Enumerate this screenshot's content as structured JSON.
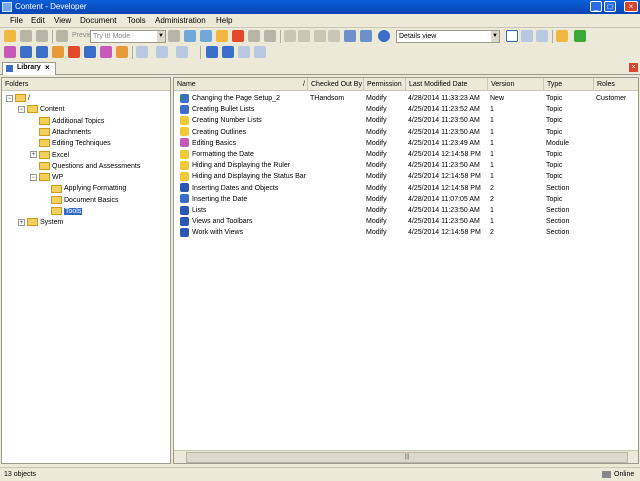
{
  "window": {
    "title": "Content - Developer"
  },
  "menu": [
    "File",
    "Edit",
    "View",
    "Document",
    "Tools",
    "Administration",
    "Help"
  ],
  "toolbar": {
    "preview_label": "Preview",
    "mode_select": "Try It! Mode",
    "view_select": "Details view"
  },
  "tab": {
    "label": "Library",
    "close": "×"
  },
  "folders_header": "Folders",
  "tree": [
    {
      "label": "/",
      "level": 0,
      "expander": "−"
    },
    {
      "label": "Content",
      "level": 1,
      "expander": "−"
    },
    {
      "label": "Additional Topics",
      "level": 2,
      "expander": ""
    },
    {
      "label": "Attachments",
      "level": 2,
      "expander": ""
    },
    {
      "label": "Editing Techniques",
      "level": 2,
      "expander": ""
    },
    {
      "label": "Excel",
      "level": 2,
      "expander": "+"
    },
    {
      "label": "Questions and Assessments",
      "level": 2,
      "expander": ""
    },
    {
      "label": "WP",
      "level": 2,
      "expander": "−"
    },
    {
      "label": "Applying Formatting",
      "level": 3,
      "expander": ""
    },
    {
      "label": "Document Basics",
      "level": 3,
      "expander": ""
    },
    {
      "label": "Tools",
      "level": 3,
      "expander": "",
      "selected": true
    },
    {
      "label": "System",
      "level": 1,
      "expander": "+"
    }
  ],
  "columns": [
    "Name",
    "/",
    "Checked Out By",
    "Permission",
    "Last Modified Date",
    "Version",
    "Type",
    "Roles"
  ],
  "rows": [
    {
      "name": "Changing the Page Setup_2",
      "checked": "THandsom",
      "perm": "Modify",
      "date": "4/28/2014 11:33:23 AM",
      "ver": "New",
      "type": "Topic",
      "roles": "Customer",
      "icon": "topic",
      "check": true
    },
    {
      "name": "Creating Bullet Lists",
      "checked": "",
      "perm": "Modify",
      "date": "4/25/2014 11:23:52 AM",
      "ver": "1",
      "type": "Topic",
      "roles": "",
      "icon": "topic"
    },
    {
      "name": "Creating Number Lists",
      "checked": "",
      "perm": "Modify",
      "date": "4/25/2014 11:23:50 AM",
      "ver": "1",
      "type": "Topic",
      "roles": "",
      "icon": "bulb"
    },
    {
      "name": "Creating Outlines",
      "checked": "",
      "perm": "Modify",
      "date": "4/25/2014 11:23:50 AM",
      "ver": "1",
      "type": "Topic",
      "roles": "",
      "icon": "bulb"
    },
    {
      "name": "Editing Basics",
      "checked": "",
      "perm": "Modify",
      "date": "4/25/2014 11:23:49 AM",
      "ver": "1",
      "type": "Module",
      "roles": "",
      "icon": "module"
    },
    {
      "name": "Formatting the Date",
      "checked": "",
      "perm": "Modify",
      "date": "4/25/2014 12:14:58 PM",
      "ver": "1",
      "type": "Topic",
      "roles": "",
      "icon": "bulb"
    },
    {
      "name": "Hiding and Displaying the Ruler",
      "checked": "",
      "perm": "Modify",
      "date": "4/25/2014 11:23:50 AM",
      "ver": "1",
      "type": "Topic",
      "roles": "",
      "icon": "bulb"
    },
    {
      "name": "Hiding and Displaying the Status Bar",
      "checked": "",
      "perm": "Modify",
      "date": "4/25/2014 12:14:58 PM",
      "ver": "1",
      "type": "Topic",
      "roles": "",
      "icon": "bulb"
    },
    {
      "name": "Inserting Dates and Objects",
      "checked": "",
      "perm": "Modify",
      "date": "4/25/2014 12:14:58 PM",
      "ver": "2",
      "type": "Section",
      "roles": "",
      "icon": "section"
    },
    {
      "name": "Inserting the Date",
      "checked": "",
      "perm": "Modify",
      "date": "4/28/2014 11:07:05 AM",
      "ver": "2",
      "type": "Topic",
      "roles": "",
      "icon": "topic"
    },
    {
      "name": "Lists",
      "checked": "",
      "perm": "Modify",
      "date": "4/25/2014 11:23:50 AM",
      "ver": "1",
      "type": "Section",
      "roles": "",
      "icon": "section"
    },
    {
      "name": "Views and Toolbars",
      "checked": "",
      "perm": "Modify",
      "date": "4/25/2014 11:23:50 AM",
      "ver": "1",
      "type": "Section",
      "roles": "",
      "icon": "section"
    },
    {
      "name": "Work with Views",
      "checked": "",
      "perm": "Modify",
      "date": "4/25/2014 12:14:58 PM",
      "ver": "2",
      "type": "Section",
      "roles": "",
      "icon": "section"
    }
  ],
  "status": {
    "count": "13 objects",
    "online": "Online"
  }
}
